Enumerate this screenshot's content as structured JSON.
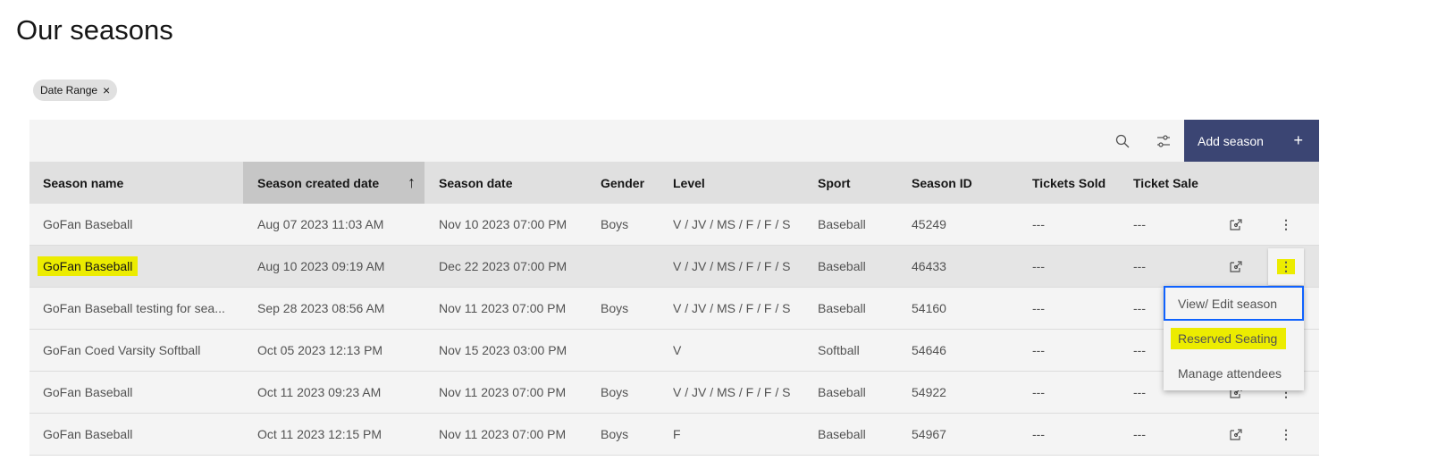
{
  "page": {
    "title": "Our seasons"
  },
  "filter_tag": {
    "label": "Date Range",
    "close": "×"
  },
  "toolbar": {
    "add_label": "Add season",
    "add_icon": "+"
  },
  "columns": [
    "Season name",
    "Season created date",
    "Season date",
    "Gender",
    "Level",
    "Sport",
    "Season ID",
    "Tickets Sold",
    "Ticket Sale"
  ],
  "rows": [
    {
      "name": "GoFan Baseball",
      "created": "Aug 07 2023 11:03 AM",
      "date": "Nov 10 2023 07:00 PM",
      "gender": "Boys",
      "level": "V / JV / MS / F / F / S",
      "sport": "Baseball",
      "id": "45249",
      "sold": "---",
      "sale": "---"
    },
    {
      "name": "GoFan Baseball",
      "created": "Aug 10 2023 09:19 AM",
      "date": "Dec 22 2023 07:00 PM",
      "gender": "",
      "level": "V / JV / MS / F / F / S",
      "sport": "Baseball",
      "id": "46433",
      "sold": "---",
      "sale": "---"
    },
    {
      "name": "GoFan Baseball testing for sea...",
      "created": "Sep 28 2023 08:56 AM",
      "date": "Nov 11 2023 07:00 PM",
      "gender": "Boys",
      "level": "V / JV / MS / F / F / S",
      "sport": "Baseball",
      "id": "54160",
      "sold": "---",
      "sale": "---"
    },
    {
      "name": "GoFan Coed Varsity Softball",
      "created": "Oct 05 2023 12:13 PM",
      "date": "Nov 15 2023 03:00 PM",
      "gender": "",
      "level": "V",
      "sport": "Softball",
      "id": "54646",
      "sold": "---",
      "sale": "---"
    },
    {
      "name": "GoFan Baseball",
      "created": "Oct 11 2023 09:23 AM",
      "date": "Nov 11 2023 07:00 PM",
      "gender": "Boys",
      "level": "V / JV / MS / F / F / S",
      "sport": "Baseball",
      "id": "54922",
      "sold": "---",
      "sale": "---"
    },
    {
      "name": "GoFan Baseball",
      "created": "Oct 11 2023 12:15 PM",
      "date": "Nov 11 2023 07:00 PM",
      "gender": "Boys",
      "level": "F",
      "sport": "Baseball",
      "id": "54967",
      "sold": "---",
      "sale": "---"
    }
  ],
  "menu": [
    "View/ Edit season",
    "Reserved Seating",
    "Manage attendees"
  ],
  "colors": {
    "accent": "#3b4573",
    "highlight": "#ecec00",
    "focus": "#0f62fe"
  }
}
